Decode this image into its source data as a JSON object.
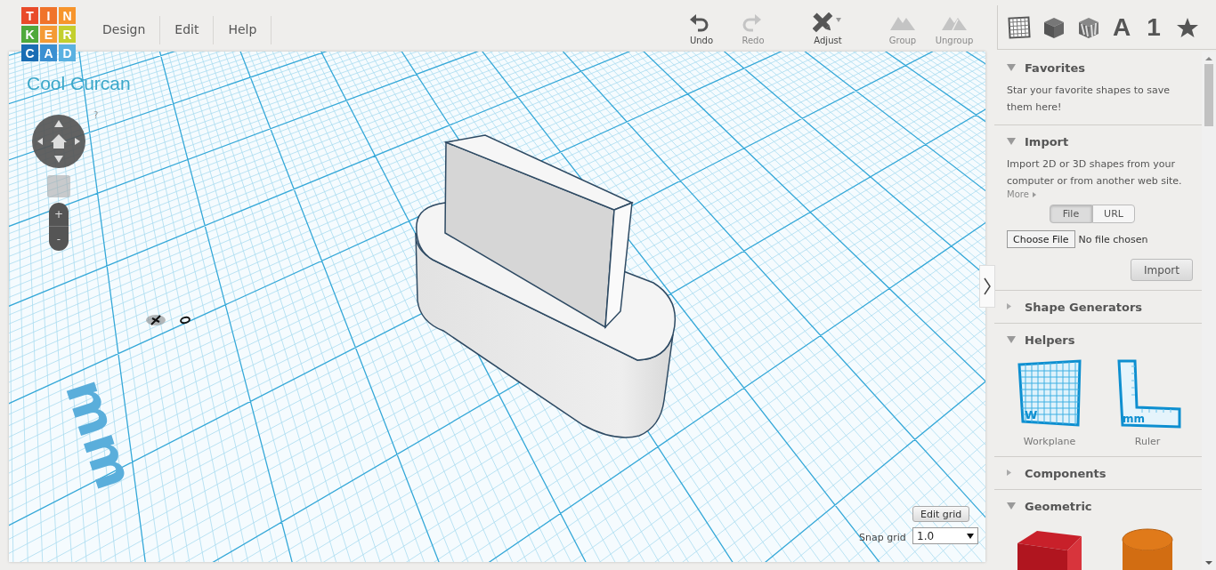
{
  "logo": {
    "tiles": [
      {
        "letter": "T",
        "color": "#e94b2a"
      },
      {
        "letter": "I",
        "color": "#f0732a"
      },
      {
        "letter": "N",
        "color": "#f7952c"
      },
      {
        "letter": "K",
        "color": "#4fa93b"
      },
      {
        "letter": "E",
        "color": "#f49a35"
      },
      {
        "letter": "R",
        "color": "#c3cf2e"
      },
      {
        "letter": "C",
        "color": "#1a6db4"
      },
      {
        "letter": "A",
        "color": "#3a8fd1"
      },
      {
        "letter": "D",
        "color": "#5ab1e1"
      }
    ]
  },
  "menu": [
    {
      "label": "Design"
    },
    {
      "label": "Edit"
    },
    {
      "label": "Help"
    }
  ],
  "toolbar": [
    {
      "kind": "undo",
      "label": "Undo",
      "disabled": false
    },
    {
      "kind": "redo",
      "label": "Redo",
      "disabled": true
    },
    {
      "kind": "adjust",
      "label": "Adjust",
      "disabled": false
    },
    {
      "kind": "group",
      "label": "Group",
      "disabled": true
    },
    {
      "kind": "ungroup",
      "label": "Ungroup",
      "disabled": true
    }
  ],
  "shape_tabs": [
    {
      "kind": "grid"
    },
    {
      "kind": "cube"
    },
    {
      "kind": "striped-cube"
    },
    {
      "kind": "text",
      "label": "A"
    },
    {
      "kind": "text",
      "label": "1"
    },
    {
      "kind": "star"
    }
  ],
  "canvas": {
    "design_title": "Cool Curcan",
    "help": "?",
    "zoom_in": "+",
    "zoom_out": "-",
    "unit_label": "mm",
    "edit_grid": "Edit grid",
    "snap_label": "Snap grid",
    "snap_value": "1.0"
  },
  "sidebar": {
    "sections": [
      {
        "kind": "text",
        "title": "Favorites",
        "expanded": true,
        "text": "Star your favorite shapes to save them here!"
      },
      {
        "kind": "import",
        "title": "Import",
        "expanded": true,
        "text": "Import 2D or 3D shapes from your computer or from another web site.",
        "more_link": "More",
        "toggle": [
          {
            "label": "File",
            "selected": true
          },
          {
            "label": "URL",
            "selected": false
          }
        ],
        "file_button": "Choose File",
        "file_status": "No file chosen",
        "import_button": "Import"
      },
      {
        "kind": "empty",
        "title": "Shape Generators",
        "expanded": false
      },
      {
        "kind": "tiles",
        "title": "Helpers",
        "expanded": true,
        "items": [
          {
            "kind": "workplane",
            "label": "Workplane",
            "badge": "W"
          },
          {
            "kind": "ruler",
            "label": "Ruler",
            "badge": "mm"
          }
        ]
      },
      {
        "kind": "empty",
        "title": "Components",
        "expanded": false
      },
      {
        "kind": "tiles",
        "title": "Geometric",
        "expanded": true,
        "items": [
          {
            "kind": "box"
          },
          {
            "kind": "cylinder"
          }
        ]
      }
    ]
  }
}
